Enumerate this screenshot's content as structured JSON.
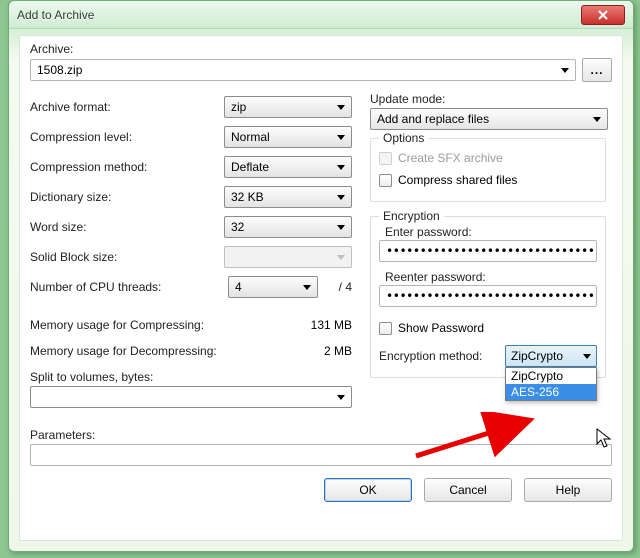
{
  "window": {
    "title": "Add to Archive"
  },
  "archive": {
    "label": "Archive:",
    "value": "1508.zip",
    "browse": "..."
  },
  "left": {
    "archive_format_label": "Archive format:",
    "archive_format_value": "zip",
    "compression_level_label": "Compression level:",
    "compression_level_value": "Normal",
    "compression_method_label": "Compression method:",
    "compression_method_value": "Deflate",
    "dictionary_label": "Dictionary size:",
    "dictionary_value": "32 KB",
    "word_size_label": "Word size:",
    "word_size_value": "32",
    "solid_block_label": "Solid Block size:",
    "solid_block_value": "",
    "cpu_threads_label": "Number of CPU threads:",
    "cpu_threads_value": "4",
    "cpu_threads_total": "/ 4",
    "mem_compress_label": "Memory usage for Compressing:",
    "mem_compress_value": "131 MB",
    "mem_decompress_label": "Memory usage for Decompressing:",
    "mem_decompress_value": "2 MB",
    "split_label": "Split to volumes, bytes:",
    "split_value": ""
  },
  "right": {
    "update_mode_label": "Update mode:",
    "update_mode_value": "Add and replace files",
    "options_legend": "Options",
    "create_sfx_label": "Create SFX archive",
    "compress_shared_label": "Compress shared files",
    "encryption_legend": "Encryption",
    "enter_password_label": "Enter password:",
    "enter_password_value": "••••••••••••••••••••••••••••••••••••••••",
    "reenter_password_label": "Reenter password:",
    "reenter_password_value": "••••••••••••••••••••••••••••••••••••••••",
    "show_password_label": "Show Password",
    "enc_method_label": "Encryption method:",
    "enc_method_value": "ZipCrypto",
    "enc_method_options": [
      "ZipCrypto",
      "AES-256"
    ]
  },
  "params": {
    "label": "Parameters:",
    "value": ""
  },
  "buttons": {
    "ok": "OK",
    "cancel": "Cancel",
    "help": "Help"
  }
}
